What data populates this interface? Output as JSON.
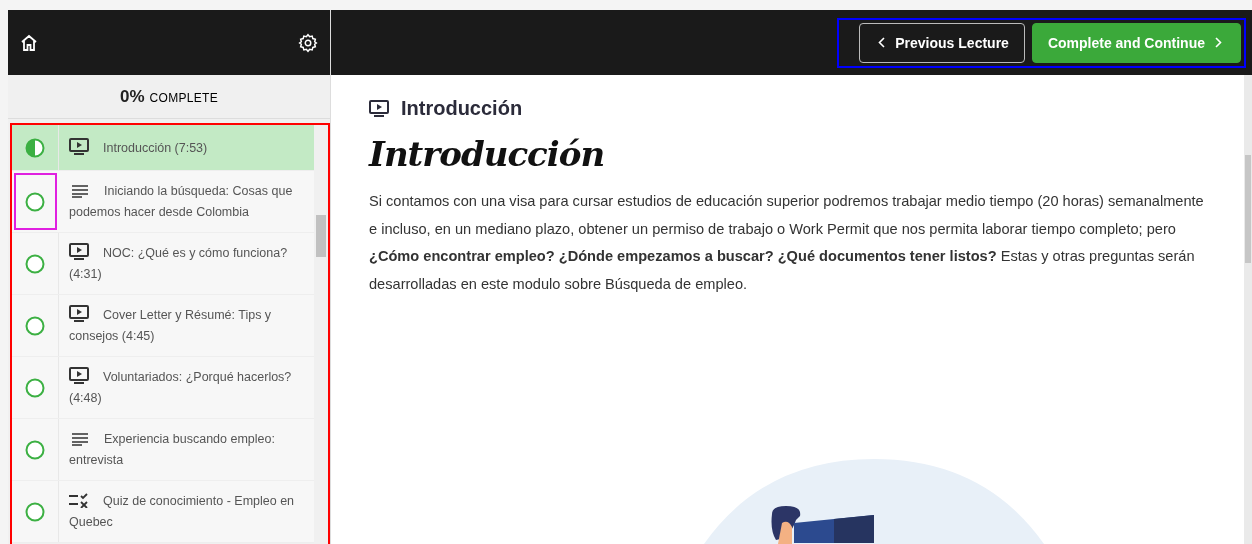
{
  "sidebar": {
    "progress": "0%",
    "progress_label": "COMPLETE",
    "lectures": [
      {
        "title": "Introducción (7:53)",
        "kind": "video",
        "in_progress": true,
        "selected": true,
        "framed": false
      },
      {
        "title": "Iniciando la búsqueda: Cosas que podemos hacer desde Colombia",
        "kind": "text",
        "in_progress": false,
        "selected": false,
        "framed": true
      },
      {
        "title": "NOC: ¿Qué es y cómo funciona? (4:31)",
        "kind": "video",
        "in_progress": false,
        "selected": false,
        "framed": false
      },
      {
        "title": "Cover Letter y Résumé: Tips y consejos (4:45)",
        "kind": "video",
        "in_progress": false,
        "selected": false,
        "framed": false
      },
      {
        "title": "Voluntariados: ¿Porqué hacerlos? (4:48)",
        "kind": "video",
        "in_progress": false,
        "selected": false,
        "framed": false
      },
      {
        "title": "Experiencia buscando empleo: entrevista",
        "kind": "text",
        "in_progress": false,
        "selected": false,
        "framed": false
      },
      {
        "title": "Quiz de conocimiento - Empleo en Quebec",
        "kind": "quiz",
        "in_progress": false,
        "selected": false,
        "framed": false
      }
    ]
  },
  "header": {
    "buttons": [
      {
        "label": "Previous Lecture",
        "kind": "previous"
      },
      {
        "label": "Complete and Continue",
        "kind": "next"
      }
    ]
  },
  "lecture": {
    "title": "Introducción",
    "heading": "Introducción",
    "body": "Si contamos con una visa para cursar estudios de educación superior podremos trabajar medio tiempo (20 horas) semanalmente e incluso, en un mediano plazo, obtener un permiso de trabajo o Work Permit que nos permita laborar tiempo completo; pero **¿Cómo encontrar empleo? ¿Dónde empezamos a buscar? ¿Qué documentos tener listos?** Estas y otras preguntas serán desarrolladas en este modulo sobre Búsqueda de empleo."
  }
}
